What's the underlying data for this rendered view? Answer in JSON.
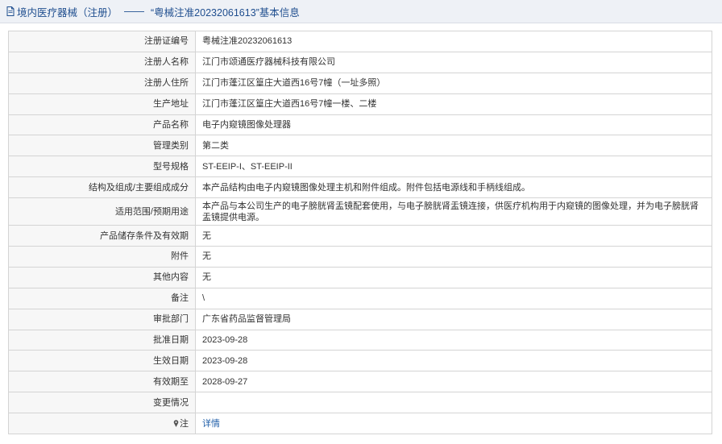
{
  "header": {
    "section": "境内医疗器械（注册）",
    "separator": "——",
    "title": "“粤械注准20232061613”基本信息"
  },
  "fields": [
    {
      "label": "注册证编号",
      "value": "粤械注准20232061613"
    },
    {
      "label": "注册人名称",
      "value": "江门市颂通医疗器械科技有限公司"
    },
    {
      "label": "注册人住所",
      "value": "江门市蓬江区篁庄大道西16号7幢（一址多照）"
    },
    {
      "label": "生产地址",
      "value": "江门市蓬江区篁庄大道西16号7幢一楼、二楼"
    },
    {
      "label": "产品名称",
      "value": "电子内窥镜图像处理器"
    },
    {
      "label": "管理类别",
      "value": "第二类"
    },
    {
      "label": "型号规格",
      "value": "ST-EEIP-I、ST-EEIP-II"
    },
    {
      "label": "结构及组成/主要组成成分",
      "value": "本产品结构由电子内窥镜图像处理主机和附件组成。附件包括电源线和手柄线组成。"
    },
    {
      "label": "适用范围/预期用途",
      "value": "本产品与本公司生产的电子膀胱肾盂镜配套使用，与电子膀胱肾盂镜连接，供医疗机构用于内窥镜的图像处理，并为电子膀胱肾盂镜提供电源。"
    },
    {
      "label": "产品储存条件及有效期",
      "value": "无"
    },
    {
      "label": "附件",
      "value": "无"
    },
    {
      "label": "其他内容",
      "value": "无"
    },
    {
      "label": "备注",
      "value": "\\"
    },
    {
      "label": "审批部门",
      "value": "广东省药品监督管理局"
    },
    {
      "label": "批准日期",
      "value": "2023-09-28"
    },
    {
      "label": "生效日期",
      "value": "2023-09-28"
    },
    {
      "label": "有效期至",
      "value": "2028-09-27"
    },
    {
      "label": "变更情况",
      "value": ""
    }
  ],
  "note": {
    "label": "注",
    "link": "详情"
  }
}
